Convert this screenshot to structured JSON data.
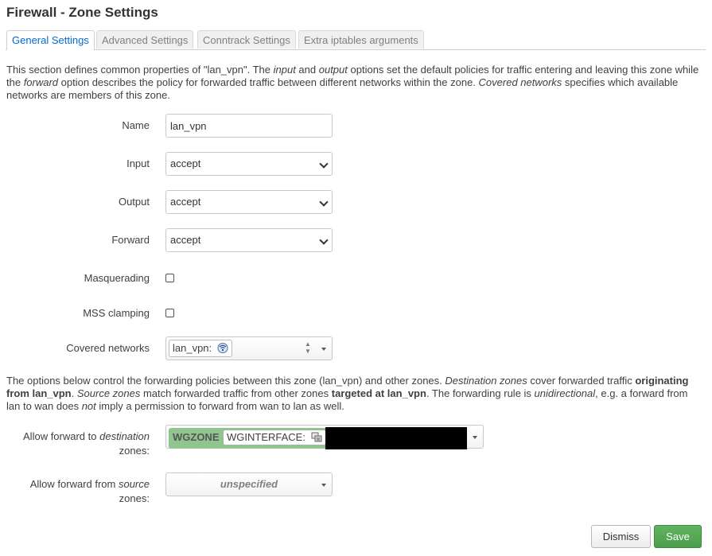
{
  "page": {
    "title": "Firewall - Zone Settings"
  },
  "tabs": [
    {
      "label": "General Settings",
      "active": true
    },
    {
      "label": "Advanced Settings",
      "active": false
    },
    {
      "label": "Conntrack Settings",
      "active": false
    },
    {
      "label": "Extra iptables arguments",
      "active": false
    }
  ],
  "intro": {
    "t1": "This section defines common properties of \"lan_vpn\". The ",
    "e1": "input",
    "t2": " and ",
    "e2": "output",
    "t3": " options set the default policies for traffic entering and leaving this zone while the ",
    "e3": "forward",
    "t4": " option describes the policy for forwarded traffic between different networks within the zone. ",
    "e4": "Covered networks",
    "t5": " specifies which available networks are members of this zone."
  },
  "form": {
    "name": {
      "label": "Name",
      "value": "lan_vpn"
    },
    "input": {
      "label": "Input",
      "value": "accept"
    },
    "output": {
      "label": "Output",
      "value": "accept"
    },
    "forward": {
      "label": "Forward",
      "value": "accept"
    },
    "masquerading": {
      "label": "Masquerading",
      "checked": false
    },
    "mss": {
      "label": "MSS clamping",
      "checked": false
    },
    "covered": {
      "label": "Covered networks",
      "chip": "lan_vpn:",
      "icon": "wireless-icon"
    }
  },
  "forwarding_intro": {
    "t1": "The options below control the forwarding policies between this zone (lan_vpn) and other zones. ",
    "e1": "Destination zones",
    "t2": " cover forwarded traffic ",
    "b1": "originating from lan_vpn",
    "t3": ". ",
    "e2": "Source zones",
    "t4": " match forwarded traffic from other zones ",
    "b2": "targeted at lan_vpn",
    "t5": ". The forwarding rule is ",
    "e3": "unidirectional",
    "t6": ", e.g. a forward from lan to wan does ",
    "e4": "not",
    "t7": " imply a permission to forward from wan to lan as well."
  },
  "forwarding": {
    "dest": {
      "label_a": "Allow forward to ",
      "label_em": "destination",
      "label_b": "zones",
      "label_c": ":",
      "zone": "WGZONE",
      "iface": "WGINTERFACE:",
      "icon": "network-icon"
    },
    "src": {
      "label_a": "Allow forward from ",
      "label_em": "source",
      "label_b": "zones",
      "label_c": ":",
      "value": "unspecified"
    }
  },
  "buttons": {
    "dismiss": "Dismiss",
    "save": "Save"
  },
  "colors": {
    "accent": "#0069d6",
    "zone": "#90c590",
    "save": "#4c9d4c"
  }
}
